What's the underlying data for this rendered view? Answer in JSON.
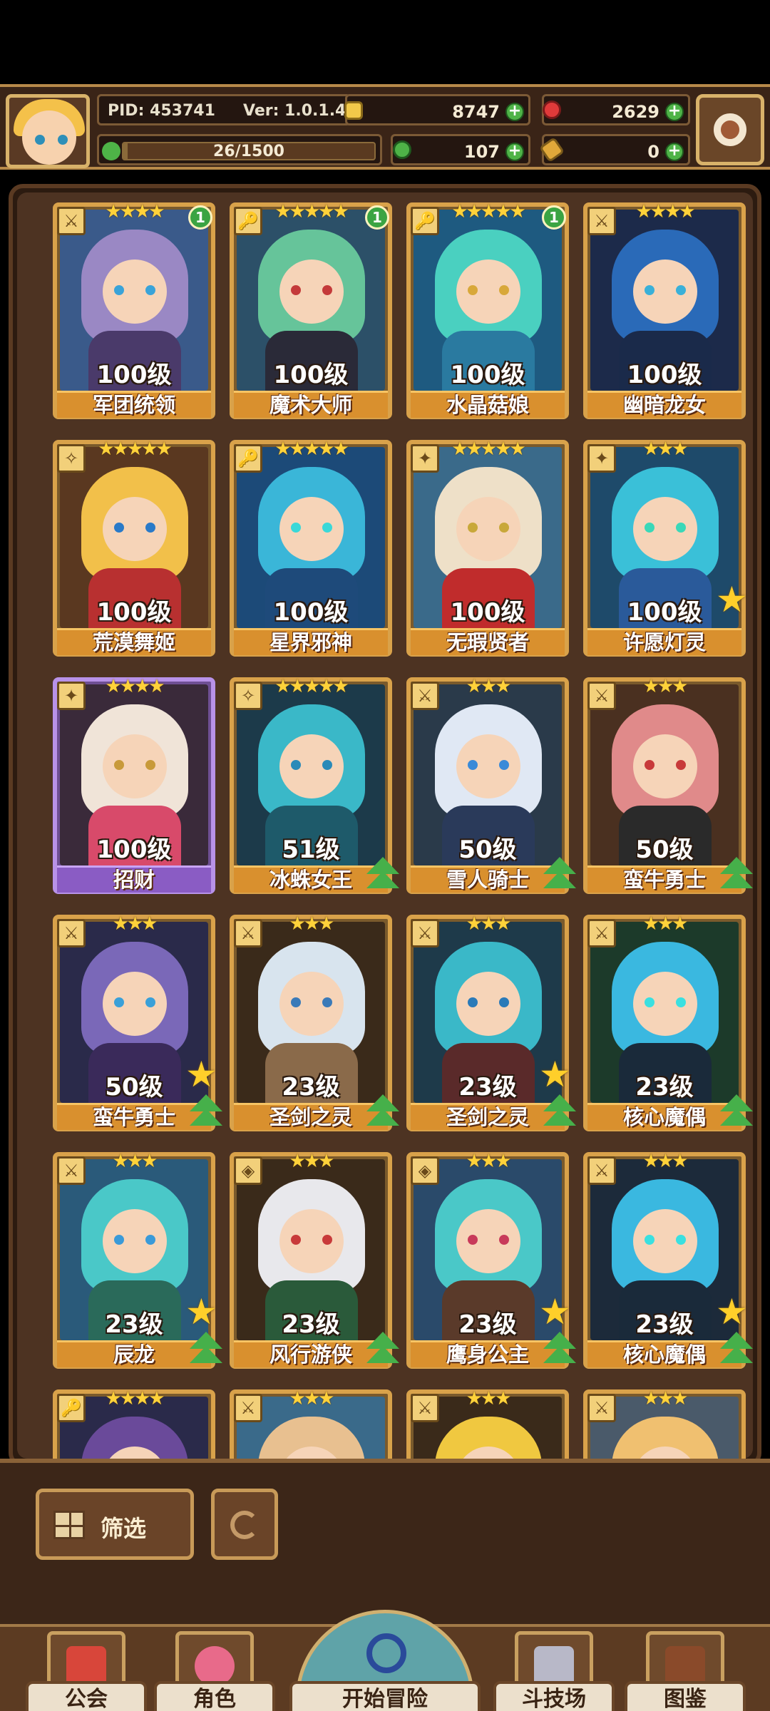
{
  "player": {
    "pid": "PID: 453741",
    "version": "Ver: 1.0.1.4",
    "xp": "26/1500",
    "xp_fraction": 0.017
  },
  "resources": {
    "gold": "8747",
    "rubies": "2629",
    "clover": "107",
    "keys": "0"
  },
  "cards": [
    {
      "level": "100级",
      "name": "军团统领",
      "stars": "★★★★",
      "role": "⚔",
      "badge": "1",
      "big_star": false,
      "upgrade": false,
      "rarity": "gold",
      "hair": "#9a88c4",
      "body": "#4a3a6a",
      "eye": "#3aa3d8",
      "bg": "#3a5a8a"
    },
    {
      "level": "100级",
      "name": "魔术大师",
      "stars": "★★★★★",
      "role": "🔑",
      "badge": "1",
      "big_star": false,
      "upgrade": false,
      "rarity": "gold",
      "hair": "#66c49a",
      "body": "#2a2a38",
      "eye": "#c43a3a",
      "bg": "#2c5068"
    },
    {
      "level": "100级",
      "name": "水晶菇娘",
      "stars": "★★★★★",
      "role": "🔑",
      "badge": "1",
      "big_star": false,
      "upgrade": false,
      "rarity": "gold",
      "hair": "#4ad0c0",
      "body": "#2a7aa0",
      "eye": "#d8a83a",
      "bg": "#1e5a80"
    },
    {
      "level": "100级",
      "name": "幽暗龙女",
      "stars": "★★★★",
      "role": "⚔",
      "badge": "",
      "big_star": false,
      "upgrade": false,
      "rarity": "gold",
      "hair": "#2a6ab8",
      "body": "#1a2a4a",
      "eye": "#3ab0d8",
      "bg": "#1c2a4a"
    },
    {
      "level": "100级",
      "name": "荒漠舞姬",
      "stars": "★★★★★",
      "role": "✧",
      "badge": "",
      "big_star": false,
      "upgrade": false,
      "rarity": "gold",
      "hair": "#f2c04a",
      "body": "#b83030",
      "eye": "#2a7ac8",
      "bg": "#5a3820"
    },
    {
      "level": "100级",
      "name": "星界邪神",
      "stars": "★★★★★",
      "role": "🔑",
      "badge": "",
      "big_star": false,
      "upgrade": false,
      "rarity": "gold",
      "hair": "#3ab6d8",
      "body": "#1e4a7a",
      "eye": "#3ad8d8",
      "bg": "#1c4a78"
    },
    {
      "level": "100级",
      "name": "无瑕贤者",
      "stars": "★★★★★",
      "role": "✦",
      "badge": "",
      "big_star": false,
      "upgrade": false,
      "rarity": "gold",
      "hair": "#eee0c8",
      "body": "#c02c2c",
      "eye": "#c8a83a",
      "bg": "#3a6a8a"
    },
    {
      "level": "100级",
      "name": "许愿灯灵",
      "stars": "★★★",
      "role": "✦",
      "badge": "",
      "big_star": true,
      "upgrade": false,
      "rarity": "gold",
      "hair": "#3ac0d8",
      "body": "#2a5a9a",
      "eye": "#3ad8b8",
      "bg": "#1e4a6a"
    },
    {
      "level": "100级",
      "name": "招财",
      "stars": "★★★★",
      "role": "✦",
      "badge": "",
      "big_star": false,
      "upgrade": false,
      "rarity": "purple",
      "hair": "#f0e4d8",
      "body": "#d84a6a",
      "eye": "#c89a3a",
      "bg": "#3a2a3a"
    },
    {
      "level": "51级",
      "name": "冰蛛女王",
      "stars": "★★★★★",
      "role": "✧",
      "badge": "",
      "big_star": false,
      "upgrade": true,
      "rarity": "gold",
      "hair": "#3ab8c8",
      "body": "#1e5a6a",
      "eye": "#2a8ab8",
      "bg": "#1c3a4a"
    },
    {
      "level": "50级",
      "name": "雪人骑士",
      "stars": "★★★",
      "role": "⚔",
      "badge": "",
      "big_star": false,
      "upgrade": true,
      "rarity": "gold",
      "hair": "#e0e8f4",
      "body": "#2a3a5a",
      "eye": "#3a8ad8",
      "bg": "#2a3a4a"
    },
    {
      "level": "50级",
      "name": "蛮牛勇士",
      "stars": "★★★",
      "role": "⚔",
      "badge": "",
      "big_star": false,
      "upgrade": true,
      "rarity": "gold",
      "hair": "#e08a8a",
      "body": "#2a2a2a",
      "eye": "#c83a3a",
      "bg": "#4a3020"
    },
    {
      "level": "50级",
      "name": "蛮牛勇士",
      "stars": "★★★",
      "role": "⚔",
      "badge": "",
      "big_star": true,
      "upgrade": true,
      "rarity": "gold",
      "hair": "#7a68b8",
      "body": "#3a2a5a",
      "eye": "#3aa0d8",
      "bg": "#2a2a4a"
    },
    {
      "level": "23级",
      "name": "圣剑之灵",
      "stars": "★★★",
      "role": "⚔",
      "badge": "",
      "big_star": false,
      "upgrade": true,
      "rarity": "gold",
      "hair": "#d8e4ee",
      "body": "#8a6a4a",
      "eye": "#3a7ab8",
      "bg": "#3a2a1a"
    },
    {
      "level": "23级",
      "name": "圣剑之灵",
      "stars": "★★★",
      "role": "⚔",
      "badge": "",
      "big_star": true,
      "upgrade": true,
      "rarity": "gold",
      "hair": "#3ab8c8",
      "body": "#5a2a2a",
      "eye": "#2a7ab8",
      "bg": "#1e3a4a"
    },
    {
      "level": "23级",
      "name": "核心魔偶",
      "stars": "★★★",
      "role": "⚔",
      "badge": "",
      "big_star": false,
      "upgrade": true,
      "rarity": "gold",
      "hair": "#3ab8e0",
      "body": "#1a2a3a",
      "eye": "#3ae0e0",
      "bg": "#1c3a2a"
    },
    {
      "level": "23级",
      "name": "辰龙",
      "stars": "★★★",
      "role": "⚔",
      "badge": "",
      "big_star": true,
      "upgrade": true,
      "rarity": "gold",
      "hair": "#4ac8c8",
      "body": "#2a6a5a",
      "eye": "#3a9ad8",
      "bg": "#2a5a7a"
    },
    {
      "level": "23级",
      "name": "风行游侠",
      "stars": "★★★",
      "role": "◈",
      "badge": "",
      "big_star": false,
      "upgrade": true,
      "rarity": "gold",
      "hair": "#e8e8ec",
      "body": "#2a5a3a",
      "eye": "#c83a3a",
      "bg": "#3a2a1a"
    },
    {
      "level": "23级",
      "name": "鹰身公主",
      "stars": "★★★",
      "role": "◈",
      "badge": "",
      "big_star": true,
      "upgrade": true,
      "rarity": "gold",
      "hair": "#4ac8c8",
      "body": "#5a3a2a",
      "eye": "#c83a5a",
      "bg": "#2a4a6a"
    },
    {
      "level": "23级",
      "name": "核心魔偶",
      "stars": "★★★",
      "role": "⚔",
      "badge": "",
      "big_star": true,
      "upgrade": true,
      "rarity": "gold",
      "hair": "#3ab8e0",
      "body": "#1a2a3a",
      "eye": "#3ae0e0",
      "bg": "#1c2a3a"
    },
    {
      "level": "",
      "name": "",
      "stars": "★★★★",
      "role": "🔑",
      "badge": "",
      "big_star": false,
      "upgrade": false,
      "rarity": "gold",
      "hair": "#6a4a9a",
      "body": "#3a2a5a",
      "eye": "#3aa0d8",
      "bg": "#2a2a4a"
    },
    {
      "level": "",
      "name": "",
      "stars": "★★★",
      "role": "⚔",
      "badge": "",
      "big_star": false,
      "upgrade": false,
      "rarity": "gold",
      "hair": "#e8c090",
      "body": "#5a3a2a",
      "eye": "#3a7ab8",
      "bg": "#3a6a8a"
    },
    {
      "level": "",
      "name": "",
      "stars": "★★★",
      "role": "⚔",
      "badge": "",
      "big_star": false,
      "upgrade": false,
      "rarity": "gold",
      "hair": "#f0c840",
      "body": "#5a3a2a",
      "eye": "#3a7ab8",
      "bg": "#3a2a1a"
    },
    {
      "level": "",
      "name": "",
      "stars": "★★★",
      "role": "⚔",
      "badge": "",
      "big_star": false,
      "upgrade": false,
      "rarity": "gold",
      "hair": "#f0c070",
      "body": "#5a3a2a",
      "eye": "#3a7ab8",
      "bg": "#4a5a6a"
    }
  ],
  "controls": {
    "filter_label": "筛选"
  },
  "nav": {
    "guild": "公会",
    "characters": "角色",
    "adventure": "开始冒险",
    "arena": "斗技场",
    "codex": "图鉴"
  },
  "colors": {
    "accent_gold": "#d9a24a",
    "accent_purple": "#b892e8",
    "plus_green": "#4eb347"
  }
}
